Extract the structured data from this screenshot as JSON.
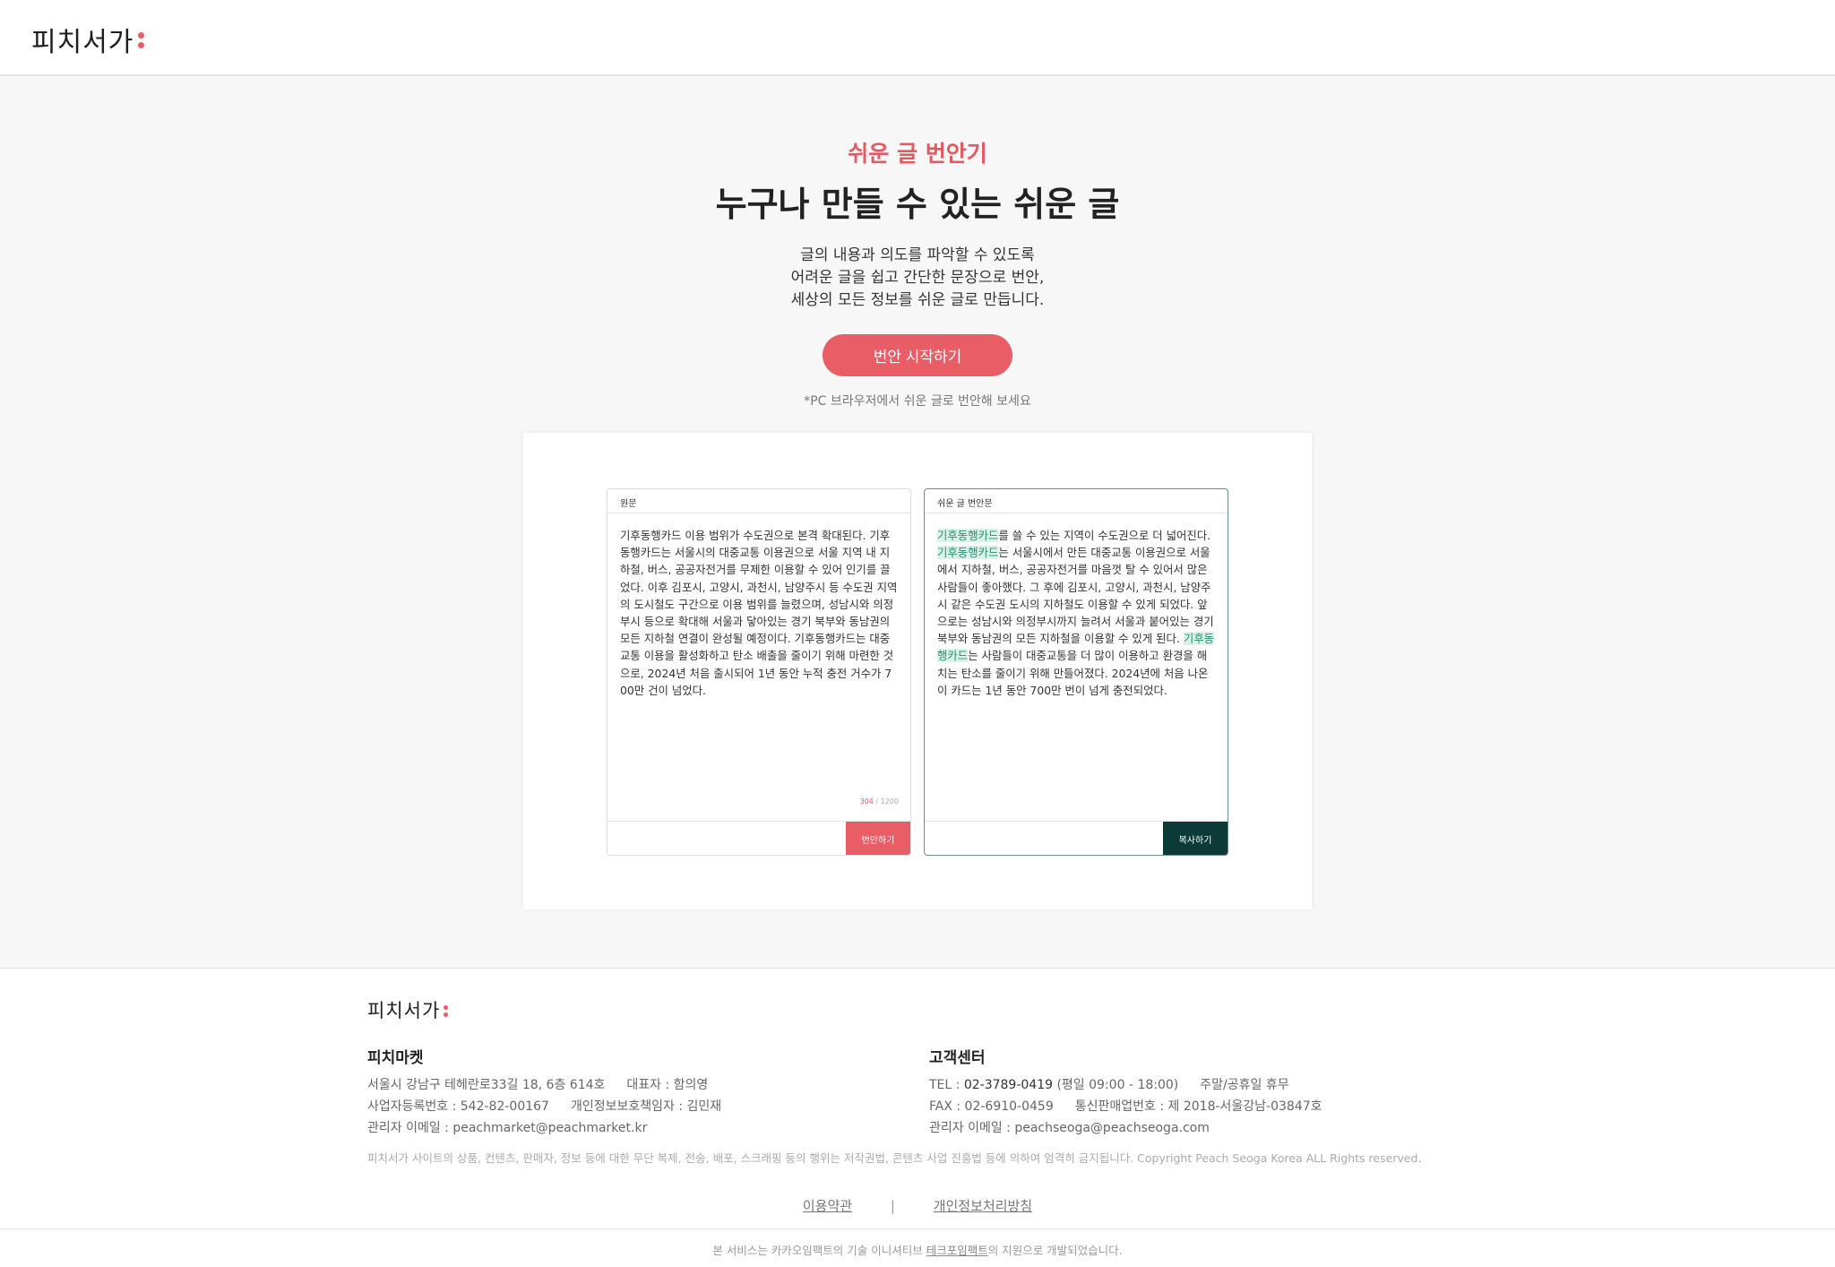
{
  "header": {
    "logo_text": "피치서가"
  },
  "hero": {
    "subtitle": "쉬운 글 번안기",
    "title": "누구나 만들 수 있는 쉬운 글",
    "desc": [
      "글의 내용과 의도를 파악할 수 있도록",
      "어려운 글을 쉽고 간단한 문장으로 번안,",
      "세상의 모든 정보를 쉬운 글로 만듭니다."
    ],
    "start_button": "번안 시작하기",
    "note": "*PC 브라우저에서 쉬운 글로 번안해 보세요"
  },
  "demo": {
    "left": {
      "label": "원문",
      "text": "기후동행카드 이용 범위가 수도권으로 본격 확대된다. 기후동행카드는 서울시의 대중교통 이용권으로 서울 지역 내 지하철, 버스, 공공자전거를 무제한 이용할 수 있어 인기를 끌었다. 이후 김포시, 고양시, 과천시, 남양주시 등 수도권 지역의 도시철도 구간으로 이용 범위를 늘렸으며, 성남시와 의정부시 등으로 확대해 서울과 닿아있는 경기 북부와 동남권의 모든 지하철 연결이 완성될 예정이다. 기후동행카드는 대중교통 이용을 활성화하고 탄소 배출을 줄이기 위해 마련한 것으로, 2024년 처음 출시되어 1년 동안 누적 충전 거수가 700만 건이 넘었다.",
      "count_current": "304",
      "count_max": "/ 1200",
      "button": "번안하기"
    },
    "right": {
      "label": "쉬운 글 번안문",
      "highlight": "기후동행카드",
      "seg1": "를 쓸 수 있는 지역이 수도권으로 더 넓어진다. ",
      "seg2": "는 서울시에서 만든 대중교통 이용권으로 서울에서 지하철, 버스, 공공자전거를 마음껏 탈 수 있어서 많은 사람들이 좋아했다. 그 후에 김포시, 고양시, 과천시, 남양주시 같은 수도권 도시의 지하철도 이용할 수 있게 되었다. 앞으로는 성남시와 의정부시까지 늘려서 서울과 붙어있는 경기 북부와 동남권의 모든 지하철을 이용할 수 있게 된다. ",
      "seg3": "는 사람들이 대중교통을 더 많이 이용하고 환경을 해치는 탄소를 줄이기 위해 만들어졌다. 2024년에 처음 나온 이 카드는 1년 동안 700만 번이 넘게 충전되었다.",
      "button": "복사하기"
    }
  },
  "footer": {
    "logo_text": "피치서가",
    "company": {
      "name": "피치마켓",
      "address": "서울시 강남구 테헤란로33길 18, 6층 614호",
      "ceo": "대표자 : 함의영",
      "biz_no": "사업자등록번호 : 542-82-00167",
      "privacy_officer": "개인정보보호책임자 : 김민재",
      "email": "관리자 이메일 : peachmarket@peachmarket.kr"
    },
    "support": {
      "name": "고객센터",
      "tel_label": "TEL : ",
      "tel": "02-3789-0419",
      "hours": "(평일 09:00 - 18:00)",
      "holiday": "주말/공휴일 휴무",
      "fax": "FAX : 02-6910-0459",
      "mail_order": "통신판매업번호 : 제 2018-서울강남-03847호",
      "email": "관리자 이메일 : peachseoga@peachseoga.com"
    },
    "copyright": "피치서가 사이트의 상품, 컨텐츠, 판매자, 정보 등에 대한 무단 복제, 전송, 배포, 스크래핑 등의 행위는 저작권법, 콘텐츠 사업 진흥법 등에 의하여 엄격히 금지됩니다.  Copyright Peach Seoga Korea ALL Rights reserved.",
    "links": {
      "terms": "이용약관",
      "separator": "|",
      "privacy": "개인정보처리방침"
    },
    "bottom": {
      "before": "본 서비스는 카카오임팩트의 기술 이니셔티브 ",
      "link": "테크포임팩트",
      "after": "의 지원으로 개발되었습니다."
    }
  }
}
